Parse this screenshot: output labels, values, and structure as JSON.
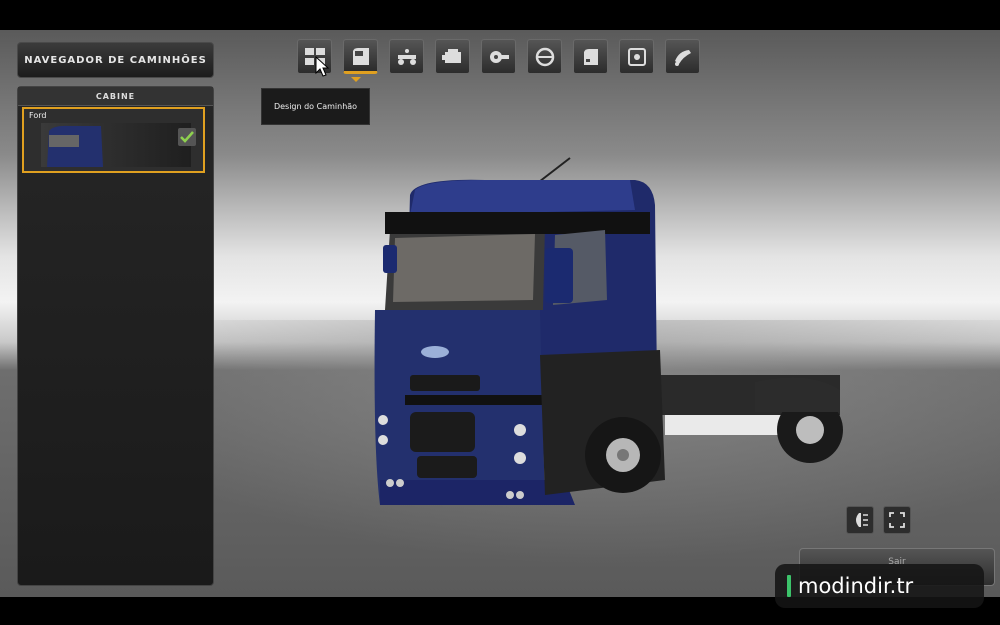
{
  "panel": {
    "title": "NAVEGADOR DE CAMINHÕES",
    "section_header": "CABINE",
    "items": [
      {
        "label": "Ford",
        "selected": true
      }
    ]
  },
  "toolbar": {
    "buttons": [
      {
        "icon": "truck-design-icon",
        "label": "Design do Caminhão"
      },
      {
        "icon": "cabin-icon"
      },
      {
        "icon": "chassis-icon"
      },
      {
        "icon": "engine-icon"
      },
      {
        "icon": "transmission-icon"
      },
      {
        "icon": "interior-icon"
      },
      {
        "icon": "lights-icon"
      },
      {
        "icon": "accessories-icon"
      },
      {
        "icon": "paint-icon"
      }
    ],
    "tooltip": "Design do Caminhão"
  },
  "controls": {
    "exit_label": "Sair"
  },
  "watermark": {
    "text": "modindir.tr"
  },
  "colors": {
    "accent": "#e0a020",
    "check": "#8fd14f",
    "truck_blue": "#1f2a6a"
  }
}
